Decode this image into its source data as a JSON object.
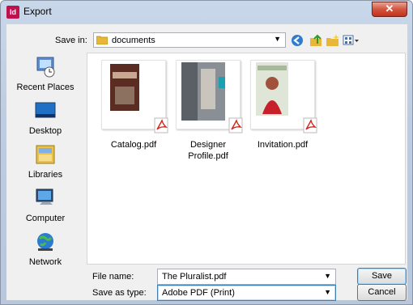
{
  "window": {
    "title": "Export",
    "app_icon": "Id",
    "close_glyph": "✕"
  },
  "toolbar": {
    "savein_label": "Save in:",
    "savein_value": "documents",
    "icons": [
      "back-icon",
      "up-folder-icon",
      "new-folder-icon",
      "view-menu-icon"
    ]
  },
  "places": [
    {
      "label": "Recent Places",
      "icon": "recent-places-icon"
    },
    {
      "label": "Desktop",
      "icon": "desktop-icon"
    },
    {
      "label": "Libraries",
      "icon": "libraries-icon"
    },
    {
      "label": "Computer",
      "icon": "computer-icon"
    },
    {
      "label": "Network",
      "icon": "network-icon"
    }
  ],
  "files": [
    {
      "name": "Catalog.pdf",
      "thumb_colors": [
        "#5a2c22",
        "#3a2018"
      ]
    },
    {
      "name": "Designer Profile.pdf",
      "thumb_colors": [
        "#7a7f86",
        "#2a7f86"
      ]
    },
    {
      "name": "Invitation.pdf",
      "thumb_colors": [
        "#d8e0d0",
        "#c8202a"
      ]
    }
  ],
  "form": {
    "filename_label": "File name:",
    "filename_value": "The Pluralist.pdf",
    "savetype_label": "Save as type:",
    "savetype_value": "Adobe PDF (Print)"
  },
  "buttons": {
    "save": "Save",
    "cancel": "Cancel"
  },
  "colors": {
    "pdf_red": "#d0271d",
    "folder_yellow": "#e8b739",
    "accent_blue": "#3c7fb1"
  }
}
